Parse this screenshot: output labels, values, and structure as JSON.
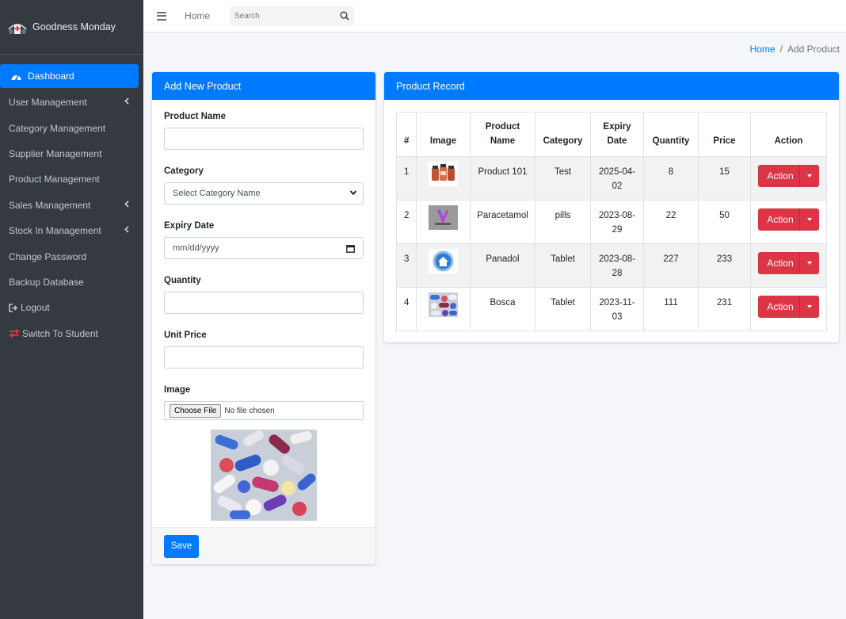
{
  "brand": {
    "name": "Goodness Monday",
    "logo_icon": "medical-logo-icon"
  },
  "sidebar": {
    "items": [
      {
        "label": "Dashboard",
        "icon": "tachometer-icon",
        "active": true
      },
      {
        "label": "User Management",
        "has_submenu": true
      },
      {
        "label": "Category Management"
      },
      {
        "label": "Supplier Management"
      },
      {
        "label": "Product Management"
      },
      {
        "label": "Sales Management",
        "has_submenu": true
      },
      {
        "label": "Stock In Management",
        "has_submenu": true
      },
      {
        "label": "Change Password"
      },
      {
        "label": "Backup Database"
      },
      {
        "label": "Logout",
        "icon": "sign-out-icon"
      },
      {
        "label": "Switch To Student",
        "icon": "exchange-icon"
      }
    ]
  },
  "topbar": {
    "home_label": "Home",
    "search_placeholder": "Search"
  },
  "breadcrumb": {
    "home": "Home",
    "separator": "/",
    "current": "Add Product"
  },
  "form": {
    "title": "Add New Product",
    "product_name_label": "Product Name",
    "category_label": "Category",
    "category_selected": "Select Category Name",
    "expiry_label": "Expiry Date",
    "expiry_placeholder": "mm/dd/yyyy",
    "quantity_label": "Quantity",
    "unit_price_label": "Unit Price",
    "image_label": "Image",
    "file_button": "Choose File",
    "file_status": "No file chosen",
    "save_label": "Save"
  },
  "record": {
    "title": "Product Record",
    "columns": {
      "num": "#",
      "image": "Image",
      "name_line1": "Product",
      "name_line2": "Name",
      "category": "Category",
      "expiry_line1": "Expiry",
      "expiry_line2": "Date",
      "quantity": "Quantity",
      "price": "Price",
      "action": "Action"
    },
    "rows": [
      {
        "num": "1",
        "name": "Product 101",
        "category": "Test",
        "expiry_line1": "2025-04-",
        "expiry_line2": "02",
        "quantity": "8",
        "price": "15",
        "action": "Action"
      },
      {
        "num": "2",
        "name": "Paracetamol",
        "category": "pills",
        "expiry_line1": "2023-08-",
        "expiry_line2": "29",
        "quantity": "22",
        "price": "50",
        "action": "Action"
      },
      {
        "num": "3",
        "name": "Panadol",
        "category": "Tablet",
        "expiry_line1": "2023-08-",
        "expiry_line2": "28",
        "quantity": "227",
        "price": "233",
        "action": "Action"
      },
      {
        "num": "4",
        "name": "Bosca",
        "category": "Tablet",
        "expiry_line1": "2023-11-",
        "expiry_line2": "03",
        "quantity": "111",
        "price": "231",
        "action": "Action"
      }
    ]
  },
  "colors": {
    "primary": "#007bff",
    "danger": "#dc3545",
    "sidebar": "#343a40"
  }
}
